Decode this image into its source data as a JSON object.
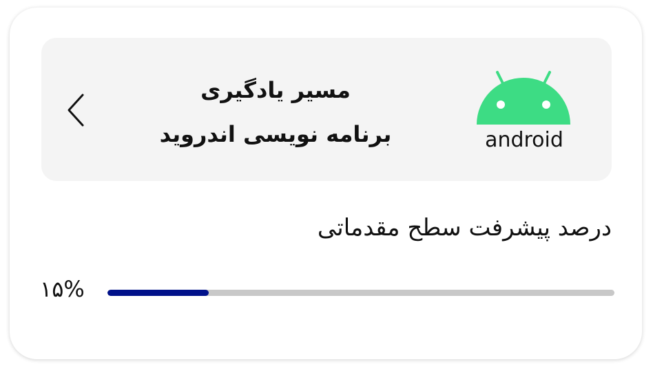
{
  "course": {
    "title_line1": "مسیر یادگیری",
    "title_line2": "برنامه نویسی اندروید",
    "logo_text": "android",
    "logo_color": "#3ddc84",
    "icons": {
      "back": "chevron-left-icon",
      "logo": "android-logo-icon"
    }
  },
  "progress": {
    "heading": "درصد پیشرفت سطح مقدماتی",
    "percent_label": "۱۵%",
    "value": 0.2,
    "fill_color": "#00118a",
    "track_color": "#c8c8c8"
  }
}
